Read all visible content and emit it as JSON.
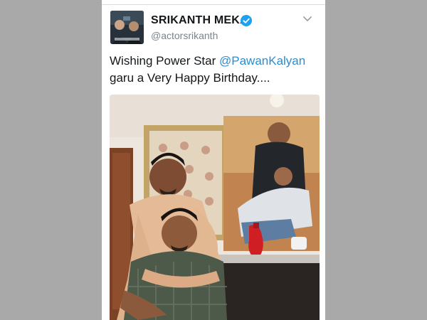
{
  "tweet": {
    "author_name": "SRIKANTH MEKA",
    "author_handle": "@actorsrikanth",
    "verified": true,
    "text_part1": "Wishing Power Star ",
    "mention": "@PawanKalyan",
    "text_part2": " garu a Very Happy Birthday...."
  },
  "icons": {
    "verified": "verified-badge-icon",
    "menu": "chevron-down-icon"
  },
  "colors": {
    "background": "#a9a9a9",
    "card": "#ffffff",
    "link": "#2a8dcf",
    "verified": "#1da1f2",
    "handle": "#7b848c"
  }
}
